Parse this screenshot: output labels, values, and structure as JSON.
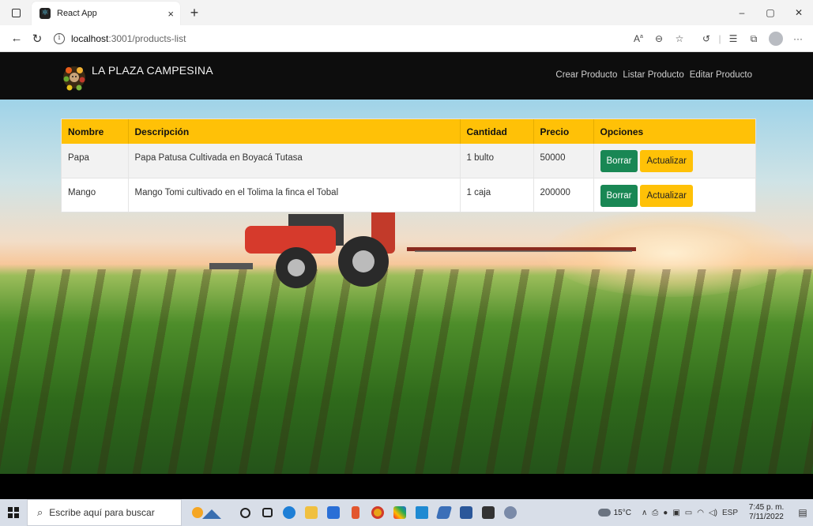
{
  "browser": {
    "tab_title": "React App",
    "tab_close": "×",
    "new_tab": "+",
    "url_host": "localhost",
    "url_path": ":3001/products-list",
    "window_controls": {
      "minimize": "–",
      "restore": "▢",
      "close": "✕"
    },
    "toolbar_icons": [
      "read-aloud-icon",
      "zoom-icon",
      "favorite-star-icon",
      "refresh-extension-icon",
      "favorites-icon",
      "collections-icon",
      "profile-avatar",
      "more-icon"
    ]
  },
  "navbar": {
    "brand": "LA PLAZA CAMPESINA",
    "links": [
      {
        "label": "Crear Producto"
      },
      {
        "label": "Listar Producto"
      },
      {
        "label": "Editar Producto"
      }
    ]
  },
  "table": {
    "headers": {
      "name": "Nombre",
      "description": "Descripción",
      "quantity": "Cantidad",
      "price": "Precio",
      "options": "Opciones"
    },
    "rows": [
      {
        "name": "Papa",
        "description": "Papa Patusa Cultivada en Boyacá Tutasa",
        "quantity": "1 bulto",
        "price": "50000",
        "delete_label": "Borrar",
        "update_label": "Actualizar"
      },
      {
        "name": "Mango",
        "description": "Mango Tomi cultivado en el Tolima la finca el Tobal",
        "quantity": "1 caja",
        "price": "200000",
        "delete_label": "Borrar",
        "update_label": "Actualizar"
      }
    ]
  },
  "colors": {
    "header_bg": "#ffc107",
    "delete_btn": "#198754",
    "update_btn": "#ffc107",
    "navbar_bg": "#0d0d0d"
  },
  "taskbar": {
    "search_placeholder": "Escribe aquí para buscar",
    "weather": "15°C",
    "language": "ESP",
    "time": "7:45 p. m.",
    "date": "7/11/2022"
  }
}
